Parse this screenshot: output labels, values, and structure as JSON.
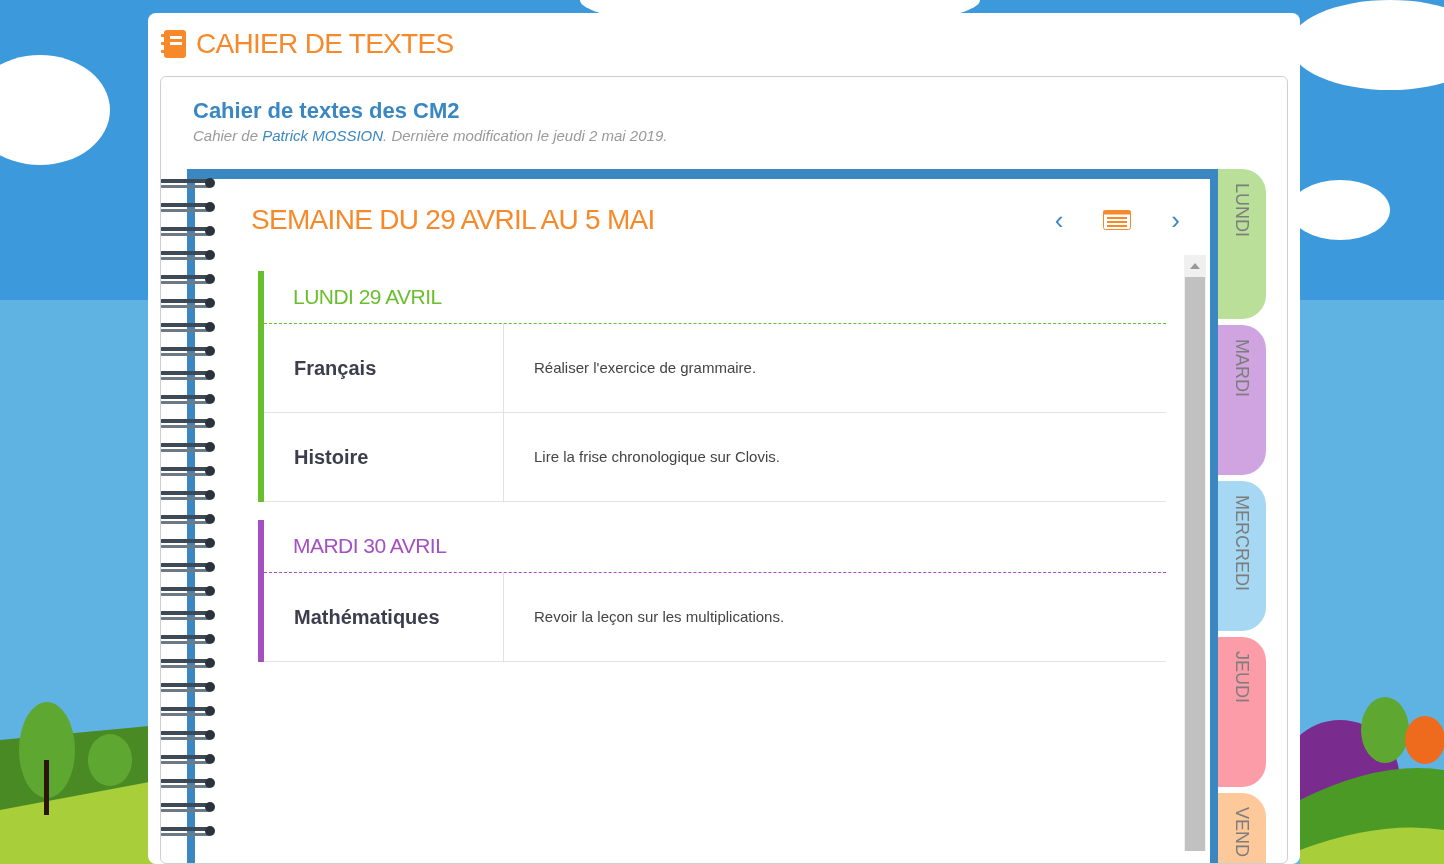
{
  "app_title": "CAHIER DE TEXTES",
  "notebook": {
    "title": "Cahier de textes des CM2",
    "subtitle_prefix": "Cahier de ",
    "author": "Patrick MOSSION",
    "subtitle_suffix": ". Dernière modification le jeudi 2 mai 2019."
  },
  "week": {
    "title": "SEMAINE DU 29 AVRIL AU 5 MAI",
    "prev": "‹",
    "next": "›"
  },
  "days": [
    {
      "title": "LUNDI 29 AVRIL",
      "color": "#6abf2e",
      "entries": [
        {
          "subject": "Français",
          "task": "Réaliser l'exercice de grammaire."
        },
        {
          "subject": "Histoire",
          "task": "Lire la frise chronologique sur Clovis."
        }
      ]
    },
    {
      "title": "MARDI 30 AVRIL",
      "color": "#a44fc2",
      "entries": [
        {
          "subject": "Mathématiques",
          "task": "Revoir la leçon sur les multiplications."
        }
      ]
    }
  ],
  "day_tabs": [
    {
      "label": "LUNDI",
      "color": "#b9df98"
    },
    {
      "label": "MARDI",
      "color": "#d0a4e0"
    },
    {
      "label": "MERCREDI",
      "color": "#a6d8f3"
    },
    {
      "label": "JEUDI",
      "color": "#fd9ca9"
    },
    {
      "label": "VEND",
      "color": "#fdc89a"
    }
  ]
}
